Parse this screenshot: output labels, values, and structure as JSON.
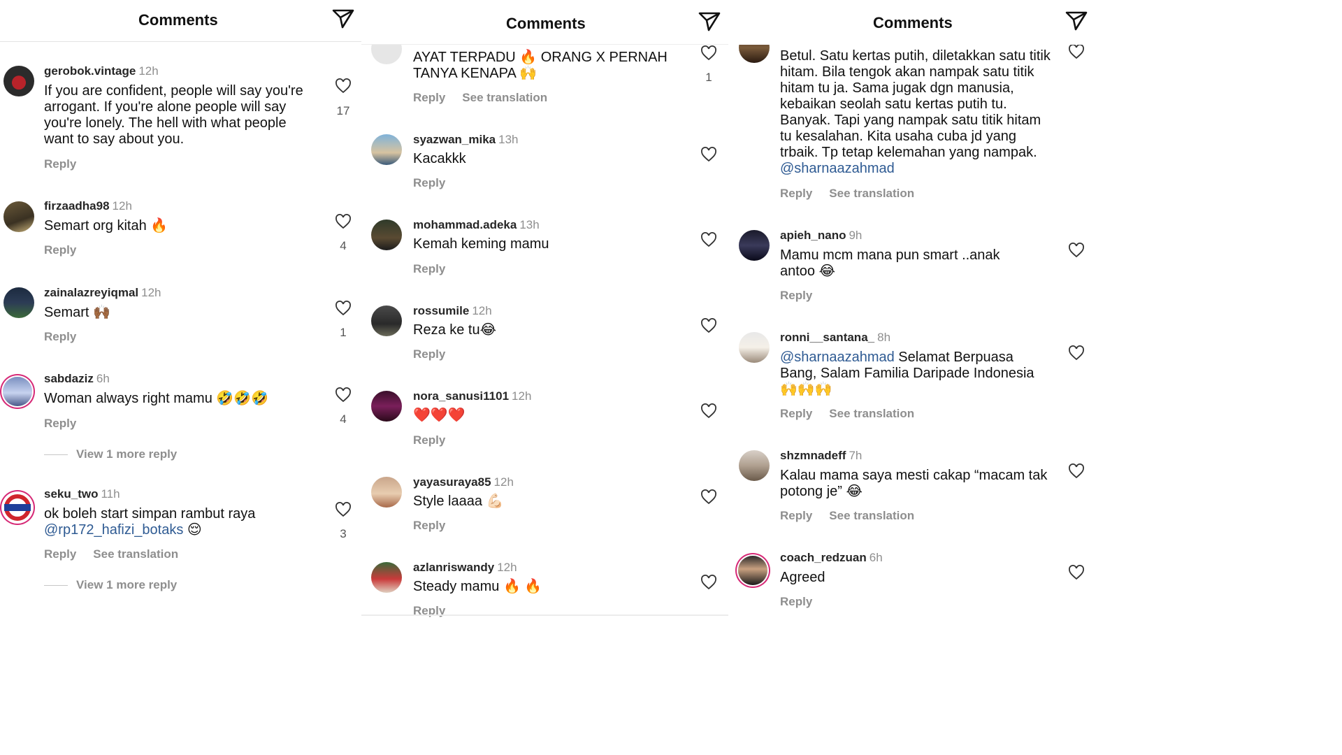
{
  "panels": [
    {
      "title": "Comments",
      "comments": [
        {
          "user": "gerobok.vintage",
          "time": "12h",
          "text": "If you are confident, people will say you're arrogant. If you're alone people will say you're lonely. The hell with what people want to say about you.",
          "reply": "Reply",
          "likes": "17"
        },
        {
          "user": "firzaadha98",
          "time": "12h",
          "text": "Semart org kitah 🔥",
          "reply": "Reply",
          "likes": "4"
        },
        {
          "user": "zainalazreyiqmal",
          "time": "12h",
          "text": "Semart 🙌🏾",
          "reply": "Reply",
          "likes": "1"
        },
        {
          "user": "sabdaziz",
          "time": "6h",
          "text": "Woman always right mamu 🤣🤣🤣",
          "reply": "Reply",
          "likes": "4",
          "view_more": "View 1 more reply"
        },
        {
          "user": "seku_two",
          "time": "11h",
          "text": "ok boleh start simpan rambut raya ",
          "mention": "@rp172_hafizi_botaks",
          "text_after": " 😌",
          "reply": "Reply",
          "see_translation": "See translation",
          "likes": "3",
          "view_more": "View 1 more reply",
          "avatar_text": "SEKUTWO"
        }
      ]
    },
    {
      "title": "Comments",
      "comments": [
        {
          "user": "",
          "time": "",
          "text": "AYAT TERPADU 🔥 ORANG X PERNAH TANYA KENAPA 🙌",
          "reply": "Reply",
          "see_translation": "See translation",
          "likes": "1"
        },
        {
          "user": "syazwan_mika",
          "time": "13h",
          "text": "Kacakkk",
          "reply": "Reply"
        },
        {
          "user": "mohammad.adeka",
          "time": "13h",
          "text": "Kemah keming mamu",
          "reply": "Reply"
        },
        {
          "user": "rossumile",
          "time": "12h",
          "text": "Reza ke tu😂",
          "reply": "Reply"
        },
        {
          "user": "nora_sanusi1101",
          "time": "12h",
          "text": "❤️❤️❤️",
          "reply": "Reply"
        },
        {
          "user": "yayasuraya85",
          "time": "12h",
          "text": "Style laaaa 💪🏻",
          "reply": "Reply"
        },
        {
          "user": "azlanriswandy",
          "time": "12h",
          "text": "Steady mamu 🔥 🔥",
          "reply": "Reply"
        }
      ]
    },
    {
      "title": "Comments",
      "comments": [
        {
          "user": "",
          "time": "",
          "text": "Betul. Satu kertas putih, diletakkan satu titik hitam. Bila tengok akan nampak satu titik hitam tu ja. Sama jugak dgn manusia, kebaikan seolah satu kertas putih tu. Banyak. Tapi yang nampak satu titik hitam tu kesalahan. Kita usaha cuba jd yang trbaik. Tp tetap kelemahan yang nampak. ",
          "mention": "@sharnaazahmad",
          "reply": "Reply",
          "see_translation": "See translation"
        },
        {
          "user": "apieh_nano",
          "time": "9h",
          "text": "Mamu mcm mana pun smart ..anak antoo 😂",
          "reply": "Reply"
        },
        {
          "user": "ronni__santana_",
          "time": "8h",
          "mention": "@sharnaazahmad",
          "text": " Selamat Berpuasa Bang, Salam Familia Daripade Indonesia 🙌🙌🙌",
          "reply": "Reply",
          "see_translation": "See translation"
        },
        {
          "user": "shzmnadeff",
          "time": "7h",
          "text": "Kalau mama saya mesti cakap “macam tak potong je” 😂",
          "reply": "Reply",
          "see_translation": "See translation"
        },
        {
          "user": "coach_redzuan",
          "time": "6h",
          "text": "Agreed",
          "reply": "Reply"
        }
      ]
    }
  ],
  "icons": {
    "send": "send-icon",
    "heart": "heart-outline-icon"
  },
  "colors": {
    "mention": "#2f5b93",
    "muted": "#8e8e8e",
    "story_ring": "#d62976"
  }
}
